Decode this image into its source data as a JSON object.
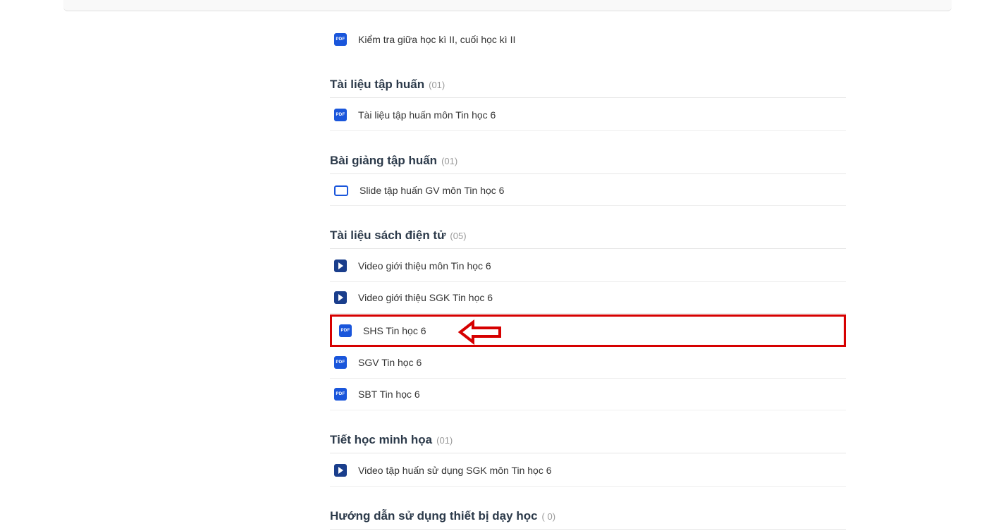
{
  "orphan_items": [
    {
      "icon": "pdf",
      "label": "Kiểm tra giữa học kì II, cuối học kì II"
    }
  ],
  "sections": [
    {
      "title": "Tài liệu tập huấn",
      "count": "(01)",
      "items": [
        {
          "icon": "pdf",
          "label": "Tài liệu tập huấn môn Tin học 6"
        }
      ]
    },
    {
      "title": "Bài giảng tập huấn",
      "count": "(01)",
      "items": [
        {
          "icon": "slide",
          "label": "Slide tập huấn GV môn Tin học 6"
        }
      ]
    },
    {
      "title": "Tài liệu sách điện tử",
      "count": "(05)",
      "items": [
        {
          "icon": "video",
          "label": "Video giới thiệu môn Tin học 6"
        },
        {
          "icon": "video",
          "label": "Video giới thiệu SGK Tin học 6"
        },
        {
          "icon": "pdf",
          "label": "SHS Tin học 6",
          "highlighted": true
        },
        {
          "icon": "pdf",
          "label": "SGV Tin học 6"
        },
        {
          "icon": "pdf",
          "label": "SBT Tin học 6"
        }
      ]
    },
    {
      "title": "Tiết học minh họa",
      "count": "(01)",
      "items": [
        {
          "icon": "video",
          "label": "Video tập huấn sử dụng SGK môn Tin học 6"
        }
      ]
    },
    {
      "title": "Hướng dẫn sử dụng thiết bị dạy học",
      "count": "( 0)",
      "items": []
    }
  ],
  "icon_text": {
    "pdf": "PDF"
  }
}
